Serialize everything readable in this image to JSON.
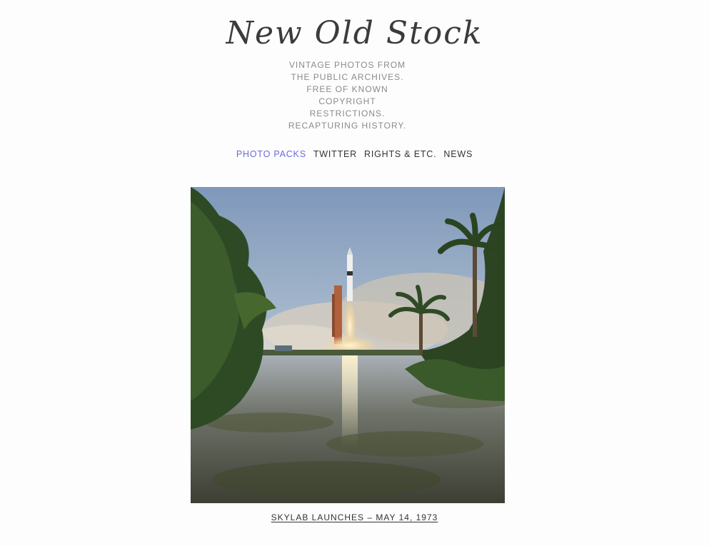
{
  "site": {
    "title": "New Old Stock",
    "tagline": [
      "VINTAGE PHOTOS FROM",
      "THE PUBLIC ARCHIVES.",
      "FREE OF KNOWN",
      "COPYRIGHT",
      "RESTRICTIONS.",
      "RECAPTURING HISTORY."
    ]
  },
  "nav": {
    "items": [
      {
        "label": "PHOTO PACKS",
        "active": true
      },
      {
        "label": "TWITTER",
        "active": false
      },
      {
        "label": "RIGHTS & ETC.",
        "active": false
      },
      {
        "label": "NEWS",
        "active": false
      }
    ],
    "active_color": "#6b6bdc"
  },
  "post": {
    "caption": "SKYLAB LAUNCHES – MAY 14, 1973"
  }
}
